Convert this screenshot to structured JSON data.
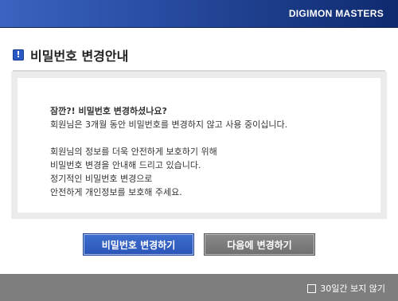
{
  "header": {
    "brand": "DIGIMON MASTERS"
  },
  "title": {
    "icon": "exclamation-icon",
    "icon_glyph": "!",
    "text": "비밀번호 변경안내"
  },
  "notice": {
    "lead": "잠깐?!  비밀번호 변경하셨나요?",
    "line1": "회원님은 3개월 동안 비밀번호를 변경하지 않고 사용 중이십니다.",
    "line2": "회원님의 정보를 더욱 안전하게 보호하기 위해",
    "line3": "비밀번호 변경을 안내해 드리고 있습니다.",
    "line4": "정기적인 비밀번호 변경으로",
    "line5": "안전하게 개인정보를 보호해 주세요."
  },
  "buttons": {
    "change_now": "비밀번호 변경하기",
    "change_later": "다음에 변경하기"
  },
  "footer": {
    "skip_label": "30일간 보지 않기",
    "skip_checked": false
  },
  "colors": {
    "brand_blue": "#2a4fa6",
    "primary_button": "#2f5bbd",
    "secondary_button": "#7a7a7a",
    "footer_bg": "#7e7e7e"
  }
}
